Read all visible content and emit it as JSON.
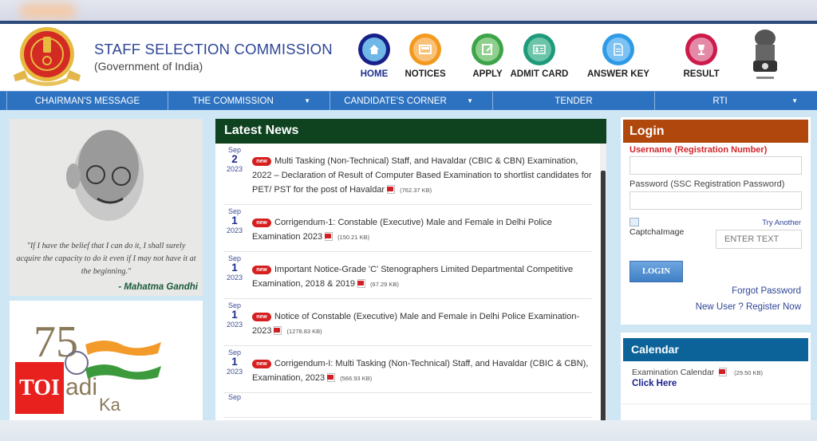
{
  "header": {
    "title": "STAFF SELECTION COMMISSION",
    "subtitle": "(Government of India)"
  },
  "quick_links": [
    {
      "label": "HOME",
      "icon": "home-icon",
      "ring": "#17208a",
      "fill": "#6fb7e6",
      "active": true
    },
    {
      "label": "NOTICES",
      "icon": "notice-board-icon",
      "ring": "#f39a1e",
      "fill": "#f9c27a",
      "active": false
    },
    {
      "label": "APPLY",
      "icon": "edit-form-icon",
      "ring": "#3fa34a",
      "fill": "#8fd08f",
      "active": false
    },
    {
      "label": "ADMIT CARD",
      "icon": "id-card-icon",
      "ring": "#1f9a7a",
      "fill": "#6cc5a8",
      "active": false
    },
    {
      "label": "ANSWER KEY",
      "icon": "document-icon",
      "ring": "#2f9be6",
      "fill": "#7cc2f2",
      "active": false
    },
    {
      "label": "RESULT",
      "icon": "trophy-icon",
      "ring": "#cc1a4a",
      "fill": "#e58aa6",
      "active": false
    }
  ],
  "nav": [
    {
      "label": "CHAIRMAN'S MESSAGE",
      "dropdown": false
    },
    {
      "label": "THE COMMISSION",
      "dropdown": true
    },
    {
      "label": "CANDIDATE'S CORNER",
      "dropdown": true
    },
    {
      "label": "TENDER",
      "dropdown": false
    },
    {
      "label": "RTI",
      "dropdown": true
    }
  ],
  "quote": {
    "text": "\"If I have the belief that I can do it, I shall surely acquire the capacity to do it even if I may not have it at the beginning.\"",
    "author": "- Mahatma Gandhi"
  },
  "azadi": {
    "badge": "TOI",
    "line1": "adi",
    "line2": "Ka"
  },
  "news": {
    "title": "Latest News",
    "new_badge": "new",
    "items": [
      {
        "month": "Sep",
        "day": "2",
        "year": "2023",
        "text": "Multi Tasking (Non-Technical) Staff, and Havaldar (CBIC & CBN) Examination, 2022 – Declaration of Result of Computer Based Examination to shortlist candidates for PET/ PST for the post of Havaldar",
        "size": "(762.37 KB)"
      },
      {
        "month": "Sep",
        "day": "1",
        "year": "2023",
        "text": "Corrigendum-1: Constable (Executive) Male and Female in Delhi Police Examination 2023",
        "size": "(150.21 KB)"
      },
      {
        "month": "Sep",
        "day": "1",
        "year": "2023",
        "text": "Important Notice-Grade 'C' Stenographers Limited Departmental Competitive Examination, 2018 & 2019",
        "size": "(67.29 KB)"
      },
      {
        "month": "Sep",
        "day": "1",
        "year": "2023",
        "text": "Notice of Constable (Executive) Male and Female in Delhi Police Examination-2023",
        "size": "(1278.83 KB)"
      },
      {
        "month": "Sep",
        "day": "1",
        "year": "2023",
        "text": "Corrigendum-I: Multi Tasking (Non-Technical) Staff, and Havaldar (CBIC & CBN), Examination, 2023",
        "size": "(566.93 KB)"
      },
      {
        "month": "Sep",
        "day": "",
        "year": "",
        "text": "",
        "size": ""
      }
    ]
  },
  "login": {
    "title": "Login",
    "username_label": "Username (Registration Number)",
    "username_value": "",
    "password_label": "Password (SSC Registration Password)",
    "password_value": "",
    "captcha_alt": "CaptchaImage",
    "try_another": "Try Another",
    "captcha_placeholder": "ENTER TEXT",
    "button": "LOGIN",
    "forgot": "Forgot Password",
    "register": "New User ? Register Now"
  },
  "calendar": {
    "title": "Calendar",
    "item": "Examination Calendar",
    "size": "(29.50 KB)",
    "link": "Click Here"
  }
}
